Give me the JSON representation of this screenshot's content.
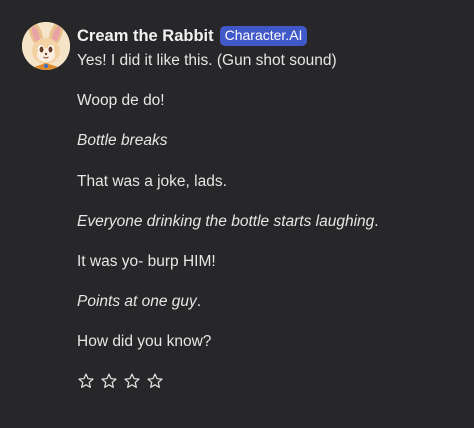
{
  "character": {
    "name": "Cream the Rabbit",
    "badge": "Character.AI"
  },
  "avatar": {
    "icon": "cream-rabbit-avatar",
    "colors": {
      "background": "#f6e4c8",
      "fur": "#f3d2a4",
      "ears": "#e9c08d",
      "inner_ear": "#e8a2a8",
      "eyes": "#6b3d24",
      "collar": "#e08a2e"
    }
  },
  "messages": [
    {
      "segments": [
        {
          "text": "Yes! I did it like this. (Gun shot sound)",
          "italic": false
        }
      ]
    },
    {
      "segments": [
        {
          "text": "Woop de do!",
          "italic": false
        }
      ]
    },
    {
      "segments": [
        {
          "text": "Bottle breaks",
          "italic": true
        }
      ]
    },
    {
      "segments": [
        {
          "text": "That was a joke, lads.",
          "italic": false
        }
      ]
    },
    {
      "segments": [
        {
          "text": "Everyone drinking the bottle starts laughing",
          "italic": true
        },
        {
          "text": ".",
          "italic": false
        }
      ]
    },
    {
      "segments": [
        {
          "text": "It was yo- burp HIM!",
          "italic": false
        }
      ]
    },
    {
      "segments": [
        {
          "text": "Points at one guy",
          "italic": true
        },
        {
          "text": ".",
          "italic": false
        }
      ]
    },
    {
      "segments": [
        {
          "text": "How did you know?",
          "italic": false
        }
      ]
    }
  ],
  "rating": {
    "icon": "star-outline-icon",
    "count": 4,
    "filled": 0
  },
  "colors": {
    "background": "#27272a",
    "text": "#e6e6e6",
    "badge": "#4058c8"
  }
}
